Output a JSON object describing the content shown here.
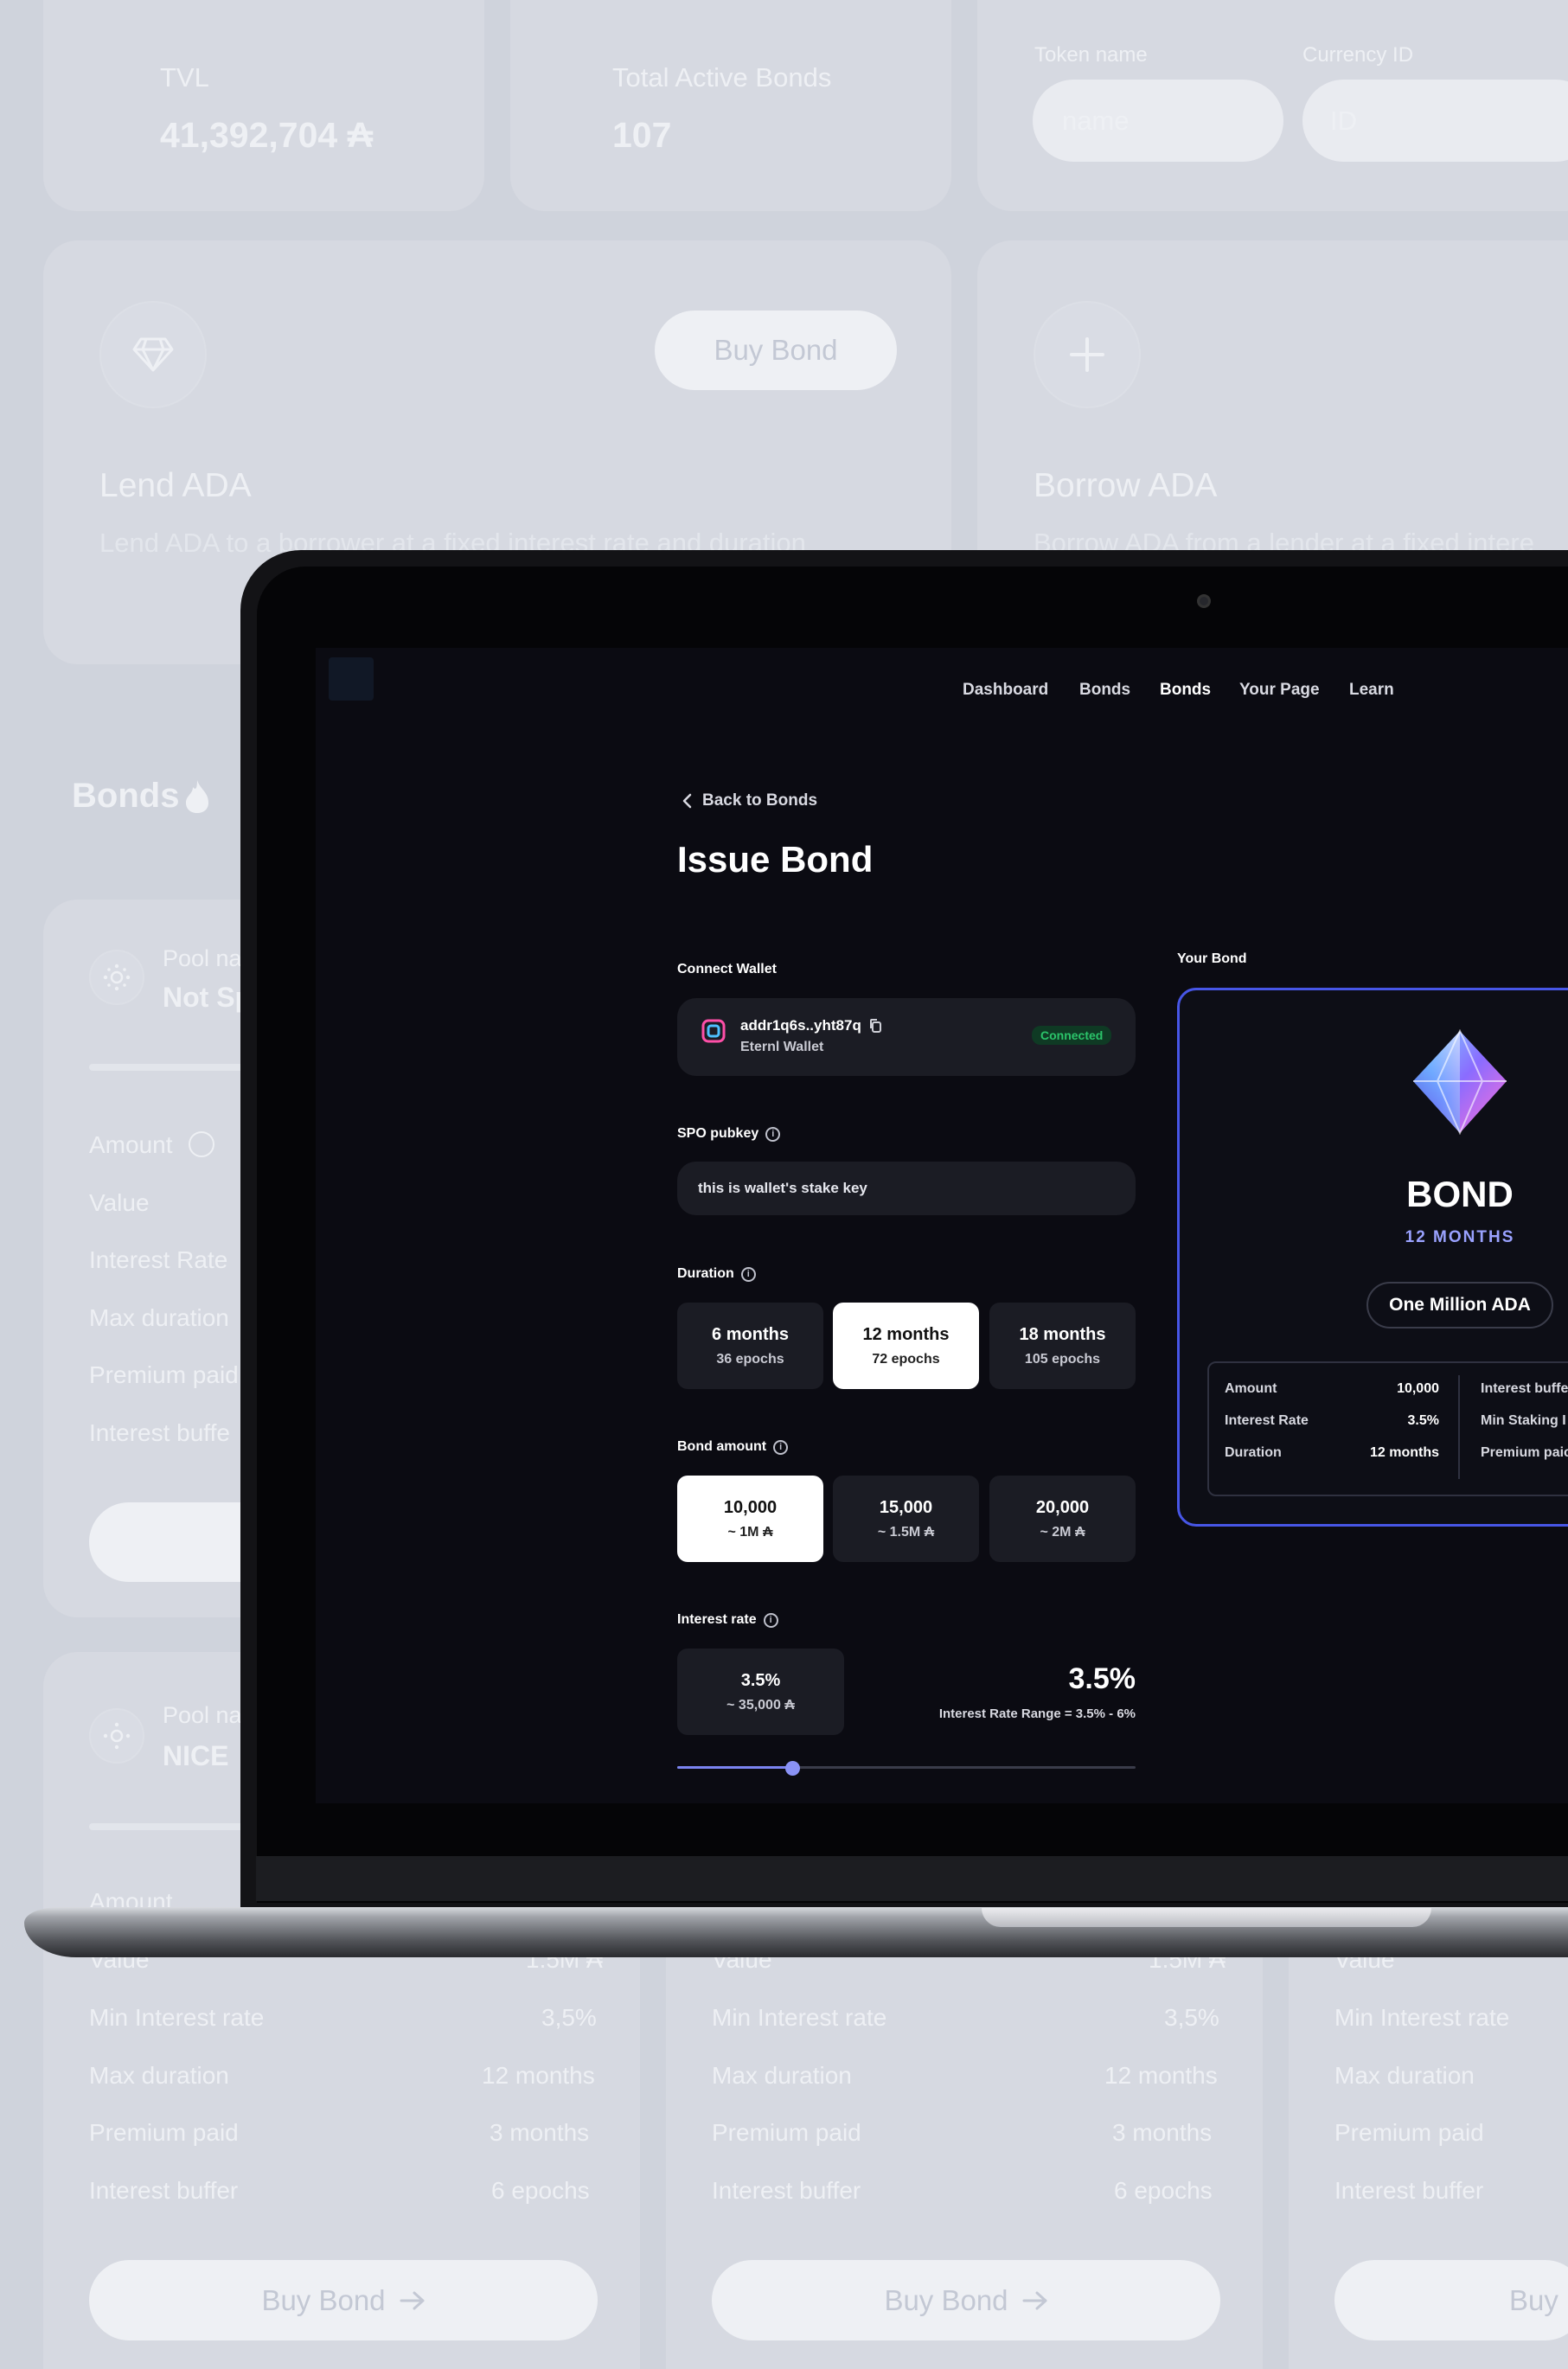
{
  "background": {
    "stats": {
      "tvl_label": "TVL",
      "tvl_value": "41,392,704 ₳",
      "active_bonds_label": "Total Active Bonds",
      "active_bonds_value": "107"
    },
    "filters": {
      "token_name_label": "Token name",
      "token_name_placeholder": "name",
      "currency_id_label": "Currency ID",
      "currency_id_placeholder": "ID"
    },
    "lend_card": {
      "title": "Lend ADA",
      "desc": "Lend ADA to a borrower at a fixed interest rate and duration",
      "button": "Buy Bond"
    },
    "borrow_card": {
      "title": "Borrow ADA",
      "desc": "Borrow ADA from a lender at a fixed intere"
    },
    "bonds_heading": "Bonds",
    "pool_label": "Pool na",
    "pool_cards": [
      {
        "pool_name": "Not Sp",
        "rows": [
          "Amount",
          "Value",
          "Interest Rate",
          "Max duration",
          "Premium paid",
          "Interest buffe"
        ]
      },
      {
        "pool_name": "NICE",
        "amount_label": "Amount"
      }
    ],
    "bottom_rows": [
      {
        "label": "Value",
        "value": "1.5M ₳"
      },
      {
        "label": "Min Interest rate",
        "value": "3,5%"
      },
      {
        "label": "Max duration",
        "value": "12 months"
      },
      {
        "label": "Premium paid",
        "value": "3 months"
      },
      {
        "label": "Interest buffer",
        "value": "6 epochs"
      }
    ],
    "buy_bond_label": "Buy Bond",
    "buy_bond_partial": "Buy B"
  },
  "app": {
    "nav": [
      "Dashboard",
      "Bonds",
      "Bonds",
      "Your Page",
      "Learn"
    ],
    "nav_active_index": 2,
    "back_link": "Back to Bonds",
    "page_title": "Issue Bond",
    "connect_wallet": {
      "label": "Connect Wallet",
      "address": "addr1q6s..yht87q",
      "wallet_name": "Eternl Wallet",
      "status": "Connected"
    },
    "spo": {
      "label": "SPO pubkey",
      "value": "this is wallet's stake key"
    },
    "duration": {
      "label": "Duration",
      "options": [
        {
          "main": "6 months",
          "sub": "36 epochs"
        },
        {
          "main": "12 months",
          "sub": "72 epochs"
        },
        {
          "main": "18 months",
          "sub": "105 epochs"
        }
      ],
      "selected_index": 1
    },
    "bond_amount": {
      "label": "Bond amount",
      "options": [
        {
          "main": "10,000",
          "sub": "~ 1M ₳"
        },
        {
          "main": "15,000",
          "sub": "~ 1.5M ₳"
        },
        {
          "main": "20,000",
          "sub": "~ 2M ₳"
        }
      ],
      "selected_index": 0
    },
    "interest": {
      "label": "Interest rate",
      "box_main": "3.5%",
      "box_sub": "~ 35,000 ₳",
      "big_value": "3.5%",
      "range_text": "Interest Rate Range = 3.5% - 6%",
      "slider_fraction": 0.25
    },
    "your_bond": {
      "label": "Your Bond",
      "title": "BOND",
      "subtitle": "12 MONTHS",
      "amount_pill": "One Million ADA",
      "rows": [
        {
          "label": "Amount",
          "value": "10,000"
        },
        {
          "label": "Interest Rate",
          "value": "3.5%"
        },
        {
          "label": "Duration",
          "value": "12 months"
        }
      ],
      "right_rows": [
        "Interest buffe",
        "Min Staking I",
        "Premium paic"
      ]
    },
    "colors": {
      "accent": "#4756e6",
      "connected": "#2bc46a",
      "slider": "#7b84f0"
    }
  }
}
